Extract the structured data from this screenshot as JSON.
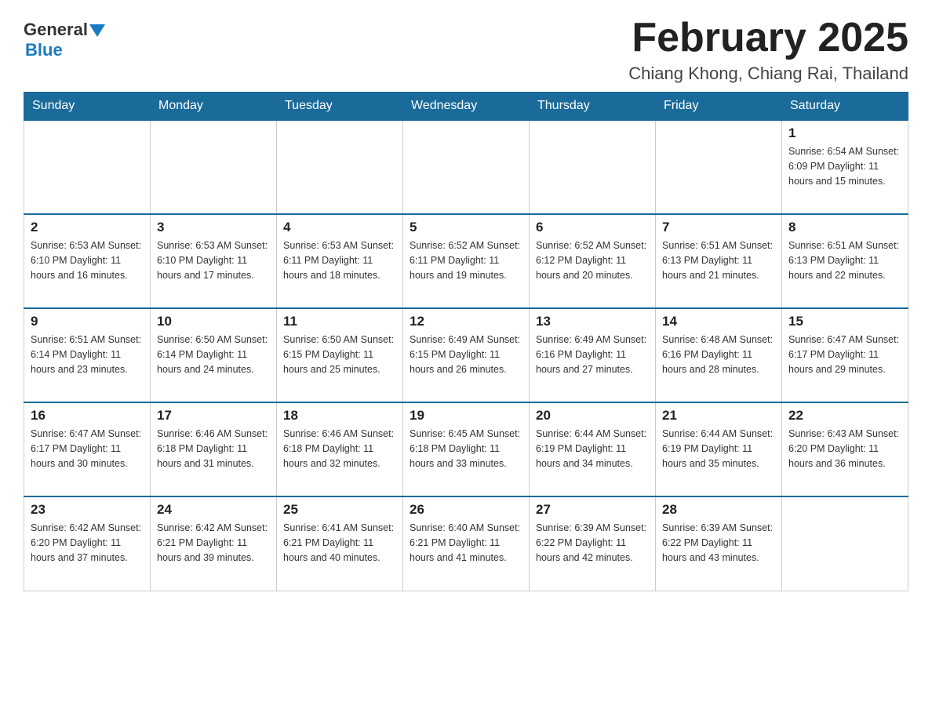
{
  "header": {
    "logo_general": "General",
    "logo_blue": "Blue",
    "month_title": "February 2025",
    "location": "Chiang Khong, Chiang Rai, Thailand"
  },
  "weekdays": [
    "Sunday",
    "Monday",
    "Tuesday",
    "Wednesday",
    "Thursday",
    "Friday",
    "Saturday"
  ],
  "weeks": [
    [
      {
        "day": "",
        "info": ""
      },
      {
        "day": "",
        "info": ""
      },
      {
        "day": "",
        "info": ""
      },
      {
        "day": "",
        "info": ""
      },
      {
        "day": "",
        "info": ""
      },
      {
        "day": "",
        "info": ""
      },
      {
        "day": "1",
        "info": "Sunrise: 6:54 AM\nSunset: 6:09 PM\nDaylight: 11 hours and 15 minutes."
      }
    ],
    [
      {
        "day": "2",
        "info": "Sunrise: 6:53 AM\nSunset: 6:10 PM\nDaylight: 11 hours and 16 minutes."
      },
      {
        "day": "3",
        "info": "Sunrise: 6:53 AM\nSunset: 6:10 PM\nDaylight: 11 hours and 17 minutes."
      },
      {
        "day": "4",
        "info": "Sunrise: 6:53 AM\nSunset: 6:11 PM\nDaylight: 11 hours and 18 minutes."
      },
      {
        "day": "5",
        "info": "Sunrise: 6:52 AM\nSunset: 6:11 PM\nDaylight: 11 hours and 19 minutes."
      },
      {
        "day": "6",
        "info": "Sunrise: 6:52 AM\nSunset: 6:12 PM\nDaylight: 11 hours and 20 minutes."
      },
      {
        "day": "7",
        "info": "Sunrise: 6:51 AM\nSunset: 6:13 PM\nDaylight: 11 hours and 21 minutes."
      },
      {
        "day": "8",
        "info": "Sunrise: 6:51 AM\nSunset: 6:13 PM\nDaylight: 11 hours and 22 minutes."
      }
    ],
    [
      {
        "day": "9",
        "info": "Sunrise: 6:51 AM\nSunset: 6:14 PM\nDaylight: 11 hours and 23 minutes."
      },
      {
        "day": "10",
        "info": "Sunrise: 6:50 AM\nSunset: 6:14 PM\nDaylight: 11 hours and 24 minutes."
      },
      {
        "day": "11",
        "info": "Sunrise: 6:50 AM\nSunset: 6:15 PM\nDaylight: 11 hours and 25 minutes."
      },
      {
        "day": "12",
        "info": "Sunrise: 6:49 AM\nSunset: 6:15 PM\nDaylight: 11 hours and 26 minutes."
      },
      {
        "day": "13",
        "info": "Sunrise: 6:49 AM\nSunset: 6:16 PM\nDaylight: 11 hours and 27 minutes."
      },
      {
        "day": "14",
        "info": "Sunrise: 6:48 AM\nSunset: 6:16 PM\nDaylight: 11 hours and 28 minutes."
      },
      {
        "day": "15",
        "info": "Sunrise: 6:47 AM\nSunset: 6:17 PM\nDaylight: 11 hours and 29 minutes."
      }
    ],
    [
      {
        "day": "16",
        "info": "Sunrise: 6:47 AM\nSunset: 6:17 PM\nDaylight: 11 hours and 30 minutes."
      },
      {
        "day": "17",
        "info": "Sunrise: 6:46 AM\nSunset: 6:18 PM\nDaylight: 11 hours and 31 minutes."
      },
      {
        "day": "18",
        "info": "Sunrise: 6:46 AM\nSunset: 6:18 PM\nDaylight: 11 hours and 32 minutes."
      },
      {
        "day": "19",
        "info": "Sunrise: 6:45 AM\nSunset: 6:18 PM\nDaylight: 11 hours and 33 minutes."
      },
      {
        "day": "20",
        "info": "Sunrise: 6:44 AM\nSunset: 6:19 PM\nDaylight: 11 hours and 34 minutes."
      },
      {
        "day": "21",
        "info": "Sunrise: 6:44 AM\nSunset: 6:19 PM\nDaylight: 11 hours and 35 minutes."
      },
      {
        "day": "22",
        "info": "Sunrise: 6:43 AM\nSunset: 6:20 PM\nDaylight: 11 hours and 36 minutes."
      }
    ],
    [
      {
        "day": "23",
        "info": "Sunrise: 6:42 AM\nSunset: 6:20 PM\nDaylight: 11 hours and 37 minutes."
      },
      {
        "day": "24",
        "info": "Sunrise: 6:42 AM\nSunset: 6:21 PM\nDaylight: 11 hours and 39 minutes."
      },
      {
        "day": "25",
        "info": "Sunrise: 6:41 AM\nSunset: 6:21 PM\nDaylight: 11 hours and 40 minutes."
      },
      {
        "day": "26",
        "info": "Sunrise: 6:40 AM\nSunset: 6:21 PM\nDaylight: 11 hours and 41 minutes."
      },
      {
        "day": "27",
        "info": "Sunrise: 6:39 AM\nSunset: 6:22 PM\nDaylight: 11 hours and 42 minutes."
      },
      {
        "day": "28",
        "info": "Sunrise: 6:39 AM\nSunset: 6:22 PM\nDaylight: 11 hours and 43 minutes."
      },
      {
        "day": "",
        "info": ""
      }
    ]
  ]
}
